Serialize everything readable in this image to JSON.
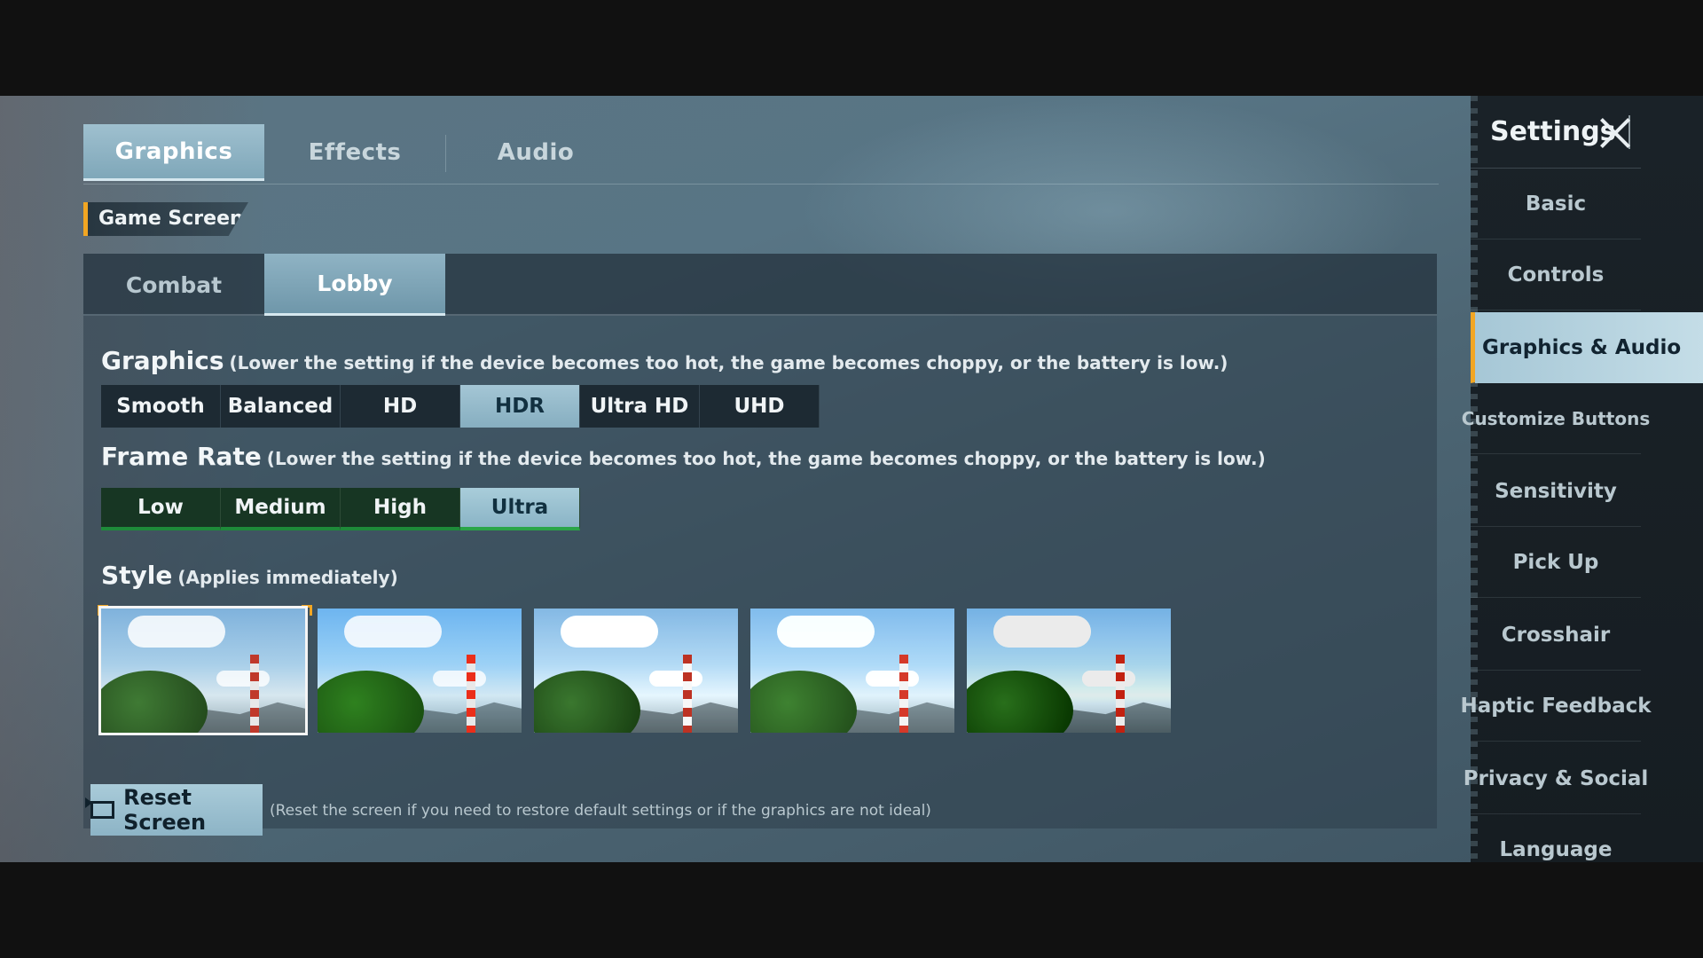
{
  "top_tabs": [
    "Graphics",
    "Effects",
    "Audio"
  ],
  "section_header": "Game Screen",
  "sub_tabs": [
    "Combat",
    "Lobby"
  ],
  "graphics": {
    "label": "Graphics",
    "note": "(Lower the setting if the device becomes too hot, the game becomes choppy, or the battery is low.)",
    "options": [
      "Smooth",
      "Balanced",
      "HD",
      "HDR",
      "Ultra HD",
      "UHD"
    ],
    "selected": "HDR"
  },
  "frame_rate": {
    "label": "Frame Rate",
    "note": "(Lower the setting if the device becomes too hot, the game becomes choppy, or the battery is low.)",
    "options": [
      "Low",
      "Medium",
      "High",
      "Ultra"
    ],
    "selected": "Ultra"
  },
  "style": {
    "label": "Style",
    "note": "(Applies immediately)",
    "selected_index": 0
  },
  "reset": {
    "label": "Reset Screen",
    "note": "(Reset the screen if you need to restore default settings or if the graphics are not ideal)"
  },
  "sidebar": {
    "title": "Settings",
    "items": [
      "Basic",
      "Controls",
      "Graphics & Audio",
      "Customize Buttons",
      "Sensitivity",
      "Pick Up",
      "Crosshair",
      "Haptic Feedback",
      "Privacy & Social",
      "Language"
    ],
    "active": "Graphics & Audio"
  },
  "colors": {
    "accent": "#f2a623",
    "selected_option": "#a4c6d5",
    "frame_rate_bar": "#1e8a3a"
  }
}
